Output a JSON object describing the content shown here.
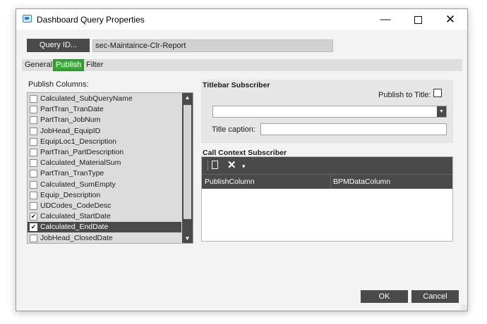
{
  "window": {
    "title": "Dashboard Query Properties",
    "controls": {
      "minimize": "—",
      "close": "✕"
    }
  },
  "query": {
    "button_label": "Query ID...",
    "value": "sec-Maintaince-Clr-Report"
  },
  "tabs": [
    {
      "label": "General",
      "active": false
    },
    {
      "label": "Publish",
      "active": true
    },
    {
      "label": "Filter",
      "active": false
    }
  ],
  "publish_columns": {
    "label": "Publish Columns:",
    "items": [
      {
        "label": "Calculated_SubQueryName",
        "checked": false,
        "selected": false
      },
      {
        "label": "PartTran_TranDate",
        "checked": false,
        "selected": false
      },
      {
        "label": "PartTran_JobNum",
        "checked": false,
        "selected": false
      },
      {
        "label": "JobHead_EquipID",
        "checked": false,
        "selected": false
      },
      {
        "label": "EquipLoc1_Description",
        "checked": false,
        "selected": false
      },
      {
        "label": "PartTran_PartDescription",
        "checked": false,
        "selected": false
      },
      {
        "label": "Calculated_MaterialSum",
        "checked": false,
        "selected": false
      },
      {
        "label": "PartTran_TranType",
        "checked": false,
        "selected": false
      },
      {
        "label": "Calculated_SumEmpty",
        "checked": false,
        "selected": false
      },
      {
        "label": "Equip_Description",
        "checked": false,
        "selected": false
      },
      {
        "label": "UDCodes_CodeDesc",
        "checked": false,
        "selected": false
      },
      {
        "label": "Calculated_StartDate",
        "checked": true,
        "selected": false
      },
      {
        "label": "Calculated_EndDate",
        "checked": true,
        "selected": true
      },
      {
        "label": "JobHead_ClosedDate",
        "checked": false,
        "selected": false
      }
    ]
  },
  "titlebar_subscriber": {
    "title": "Titlebar Subscriber",
    "publish_to_title_label": "Publish to Title:",
    "publish_to_title_checked": false,
    "dropdown_value": "",
    "title_caption_label": "Title caption:",
    "title_caption_value": ""
  },
  "call_context_subscriber": {
    "title": "Call Context Subscriber",
    "columns": [
      "PublishColumn",
      "BPMDataColumn"
    ],
    "rows": []
  },
  "buttons": {
    "ok": "OK",
    "cancel": "Cancel"
  },
  "colors": {
    "accent_green": "#34b233",
    "dark_control": "#4a4a4a"
  }
}
